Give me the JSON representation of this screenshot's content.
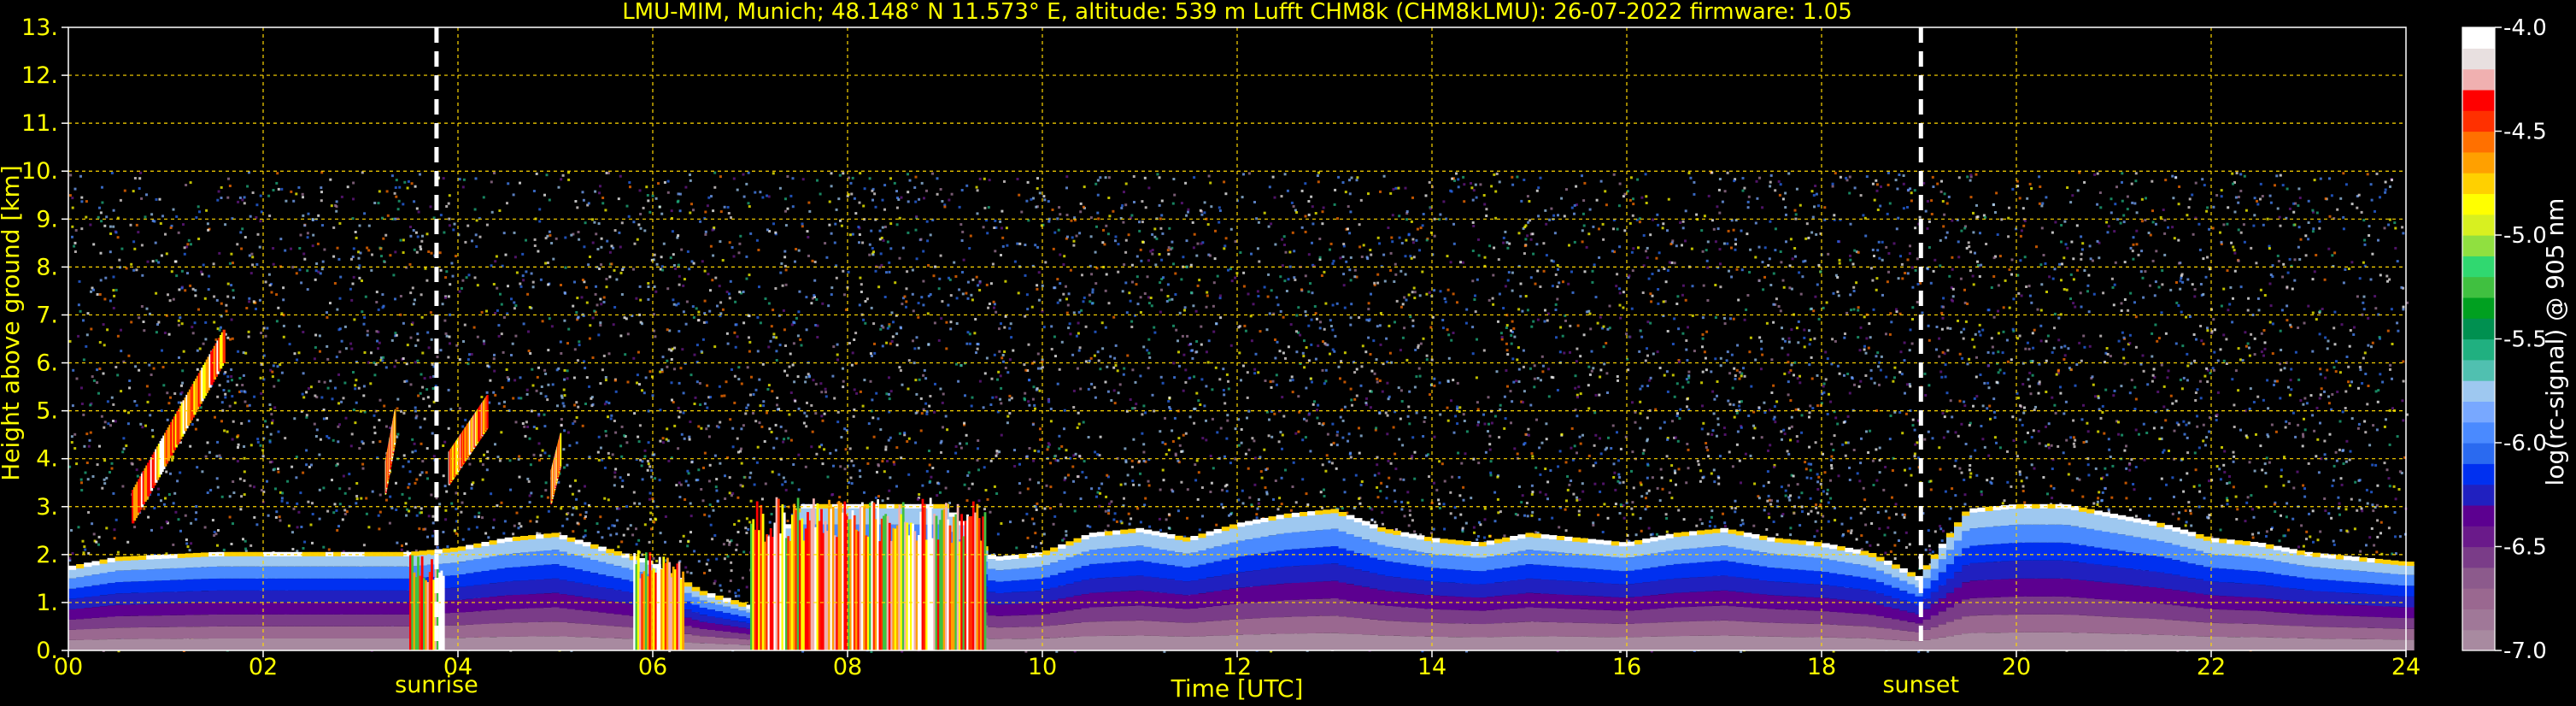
{
  "chart_data": {
    "type": "heatmap",
    "title": "LMU-MIM, Munich; 48.148° N 11.573° E, altitude: 539 m    Lufft CHM8k (CHM8kLMU): 26-07-2022    firmware: 1.05",
    "xlabel": "Time [UTC]",
    "ylabel": "Height above ground [km]",
    "xlim": [
      0,
      24
    ],
    "ylim": [
      0,
      13
    ],
    "x_ticks": [
      "00",
      "02",
      "04",
      "06",
      "08",
      "10",
      "12",
      "14",
      "16",
      "18",
      "20",
      "22",
      "24"
    ],
    "y_ticks": [
      "0.",
      "1.",
      "2.",
      "3.",
      "4.",
      "5.",
      "6.",
      "7.",
      "8.",
      "9.",
      "10.",
      "11.",
      "12.",
      "13."
    ],
    "grid": true,
    "events": [
      {
        "label": "sunrise",
        "time": 3.78
      },
      {
        "label": "sunset",
        "time": 19.02
      }
    ],
    "data_top_km": 10,
    "colorbar": {
      "label": "log(rc-signal) @ 905 nm",
      "range": [
        -7.0,
        -4.0
      ],
      "ticks": [
        "-4.0",
        "-4.5",
        "-5.0",
        "-5.5",
        "-6.0",
        "-6.5",
        "-7.0"
      ],
      "colors": [
        "#a88aa0",
        "#a07898",
        "#9a6890",
        "#8c5a8c",
        "#7a3c88",
        "#6a1a8a",
        "#5c0090",
        "#2020c0",
        "#0030f0",
        "#2a6af0",
        "#4a8aff",
        "#78a8ff",
        "#9ec8f0",
        "#50c0b0",
        "#20b080",
        "#009050",
        "#00a020",
        "#40c040",
        "#30d870",
        "#90e040",
        "#d8f020",
        "#ffff00",
        "#ffd000",
        "#ffa000",
        "#ff7000",
        "#ff3000",
        "#ff0000",
        "#f0b0b0",
        "#e8e0e0",
        "#ffffff"
      ]
    },
    "boundary_layer_top_km": [
      [
        0.0,
        1.7
      ],
      [
        0.5,
        1.9
      ],
      [
        1.0,
        1.95
      ],
      [
        1.5,
        2.0
      ],
      [
        2.0,
        2.0
      ],
      [
        2.5,
        2.0
      ],
      [
        3.0,
        2.0
      ],
      [
        3.5,
        2.0
      ],
      [
        4.0,
        2.1
      ],
      [
        4.5,
        2.3
      ],
      [
        5.0,
        2.4
      ],
      [
        5.5,
        2.1
      ],
      [
        6.0,
        1.8
      ],
      [
        6.5,
        1.2
      ],
      [
        7.0,
        0.9
      ],
      [
        7.5,
        3.0
      ],
      [
        8.0,
        3.0
      ],
      [
        8.5,
        3.0
      ],
      [
        9.0,
        3.0
      ],
      [
        9.5,
        1.9
      ],
      [
        10.0,
        2.0
      ],
      [
        10.5,
        2.4
      ],
      [
        11.0,
        2.5
      ],
      [
        11.5,
        2.3
      ],
      [
        12.0,
        2.6
      ],
      [
        12.5,
        2.8
      ],
      [
        13.0,
        2.9
      ],
      [
        13.5,
        2.5
      ],
      [
        14.0,
        2.3
      ],
      [
        14.5,
        2.2
      ],
      [
        15.0,
        2.4
      ],
      [
        15.5,
        2.3
      ],
      [
        16.0,
        2.2
      ],
      [
        16.5,
        2.4
      ],
      [
        17.0,
        2.5
      ],
      [
        17.5,
        2.3
      ],
      [
        18.0,
        2.2
      ],
      [
        18.5,
        2.0
      ],
      [
        19.0,
        1.5
      ],
      [
        19.5,
        2.9
      ],
      [
        20.0,
        3.0
      ],
      [
        20.5,
        3.0
      ],
      [
        21.0,
        2.8
      ],
      [
        21.5,
        2.6
      ],
      [
        22.0,
        2.3
      ],
      [
        22.5,
        2.2
      ],
      [
        23.0,
        2.0
      ],
      [
        23.5,
        1.9
      ],
      [
        24.0,
        1.8
      ]
    ],
    "elevated_layers": [
      {
        "t0": 0.65,
        "t1": 1.6,
        "z0": 3.0,
        "z1": 6.4
      },
      {
        "t0": 3.25,
        "t1": 3.35,
        "z0": 3.6,
        "z1": 4.7
      },
      {
        "t0": 3.9,
        "t1": 4.3,
        "z0": 3.8,
        "z1": 5.0
      },
      {
        "t0": 4.95,
        "t1": 5.05,
        "z0": 3.4,
        "z1": 4.2
      }
    ],
    "dense_cloud_periods": [
      {
        "t0": 3.5,
        "t1": 3.85,
        "z0": 0.0,
        "z1": 2.0
      },
      {
        "t0": 5.8,
        "t1": 6.3,
        "z0": 0.0,
        "z1": 2.1
      },
      {
        "t0": 7.0,
        "t1": 9.4,
        "z0": 0.0,
        "z1": 3.2
      }
    ]
  }
}
